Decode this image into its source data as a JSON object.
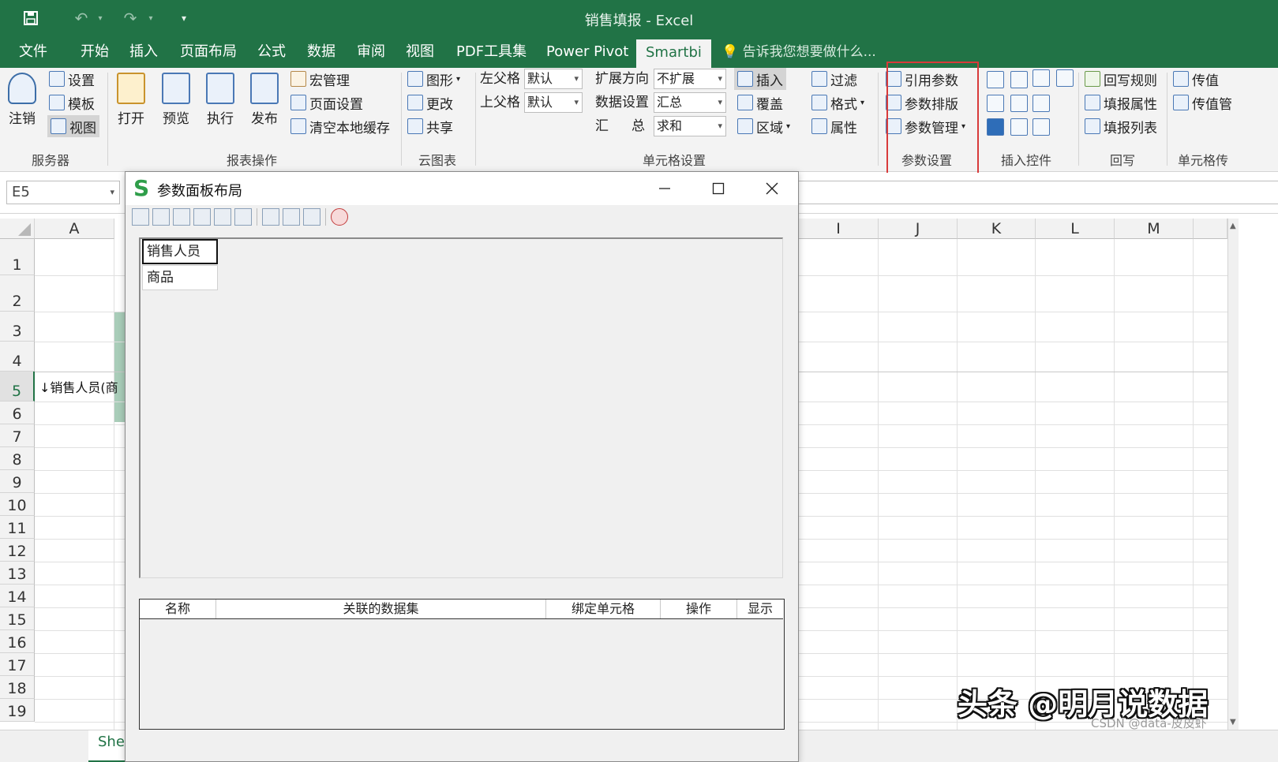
{
  "window": {
    "title": "销售填报 - Excel"
  },
  "quick_access": {
    "save_icon": "save-icon",
    "undo_icon": "undo-icon",
    "redo_icon": "redo-icon",
    "customize_icon": "customize-icon"
  },
  "menu_tabs": [
    "文件",
    "开始",
    "插入",
    "页面布局",
    "公式",
    "数据",
    "审阅",
    "视图",
    "PDF工具集",
    "Power Pivot",
    "Smartbi"
  ],
  "active_tab": "Smartbi",
  "tell_me": "告诉我您想要做什么...",
  "ribbon": {
    "server": {
      "logout": "注销",
      "settings": "设置",
      "template": "模板",
      "view": "视图",
      "group": "服务器"
    },
    "report_ops": {
      "open": "打开",
      "preview": "预览",
      "execute": "执行",
      "publish": "发布",
      "macro": "宏管理",
      "page_setup": "页面设置",
      "clear_cache": "清空本地缓存",
      "group": "报表操作"
    },
    "cloud_chart": {
      "chart": "图形",
      "change": "更改",
      "share": "共享",
      "group": "云图表"
    },
    "cell_settings": {
      "left_parent_label": "左父格",
      "left_parent_value": "默认",
      "top_parent_label": "上父格",
      "top_parent_value": "默认",
      "expand_label": "扩展方向",
      "expand_value": "不扩展",
      "data_label": "数据设置",
      "data_value": "汇总",
      "sum_label_1": "汇",
      "sum_label_2": "总",
      "sum_value": "求和",
      "insert": "插入",
      "cover": "覆盖",
      "region": "区域",
      "filter": "过滤",
      "format": "格式",
      "property": "属性",
      "group": "单元格设置"
    },
    "param_settings": {
      "ref_param": "引用参数",
      "param_layout": "参数排版",
      "param_manage": "参数管理",
      "group": "参数设置"
    },
    "insert_control": {
      "group": "插入控件"
    },
    "writeback": {
      "rule": "回写规则",
      "fill_property": "填报属性",
      "fill_list": "填报列表",
      "group": "回写"
    },
    "cell_pass": {
      "pass_value": "传值",
      "pass_manage": "传值管",
      "group": "单元格传"
    }
  },
  "formula_bar": {
    "name_box": "E5"
  },
  "sheet": {
    "columns": [
      "A",
      "I",
      "J",
      "K",
      "L",
      "M"
    ],
    "rows": [
      "1",
      "2",
      "3",
      "4",
      "5",
      "6",
      "7",
      "8",
      "9",
      "10",
      "11",
      "12",
      "13",
      "14",
      "15",
      "16",
      "17",
      "18",
      "19"
    ],
    "selected_row": "5",
    "a5_text": "↓销售人员(商",
    "sheet_tab": "She"
  },
  "dialog": {
    "title": "参数面板布局",
    "logo": "S",
    "layout_items": [
      "销售人员",
      "商品"
    ],
    "table_headers": [
      "名称",
      "关联的数据集",
      "绑定单元格",
      "操作",
      "显示"
    ]
  },
  "watermark": {
    "main": "头条 @明月说数据",
    "csdn": "CSDN @data-皮皮虾"
  },
  "colors": {
    "excel_green": "#217346",
    "highlight_red": "#d83a3a",
    "dialog_bg": "#f0f0f0"
  }
}
